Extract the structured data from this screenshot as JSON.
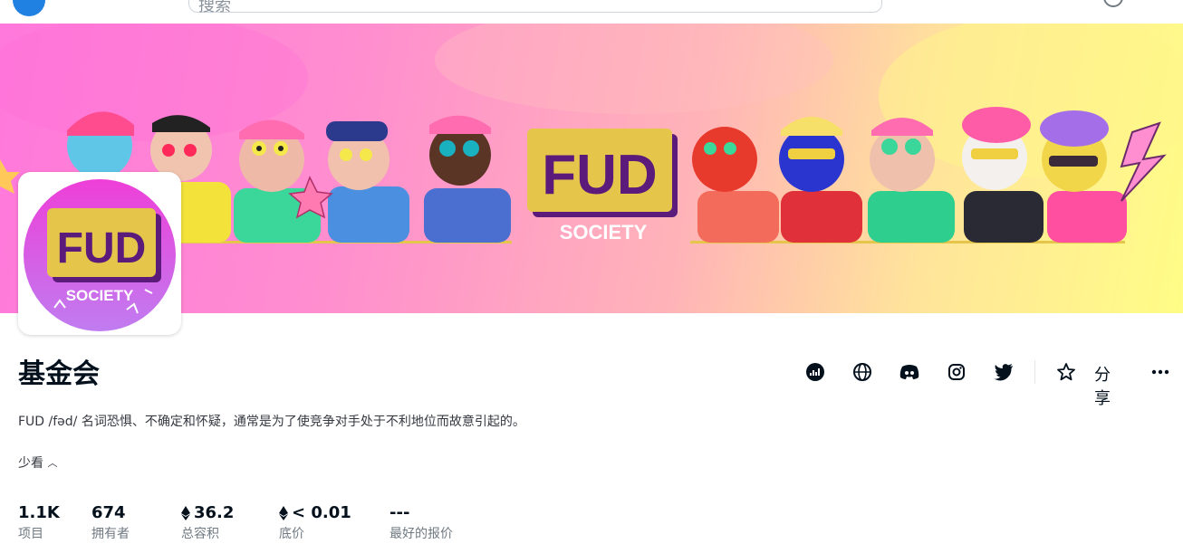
{
  "header": {
    "search_placeholder": "搜索"
  },
  "collection": {
    "title": "基金会",
    "description": "FUD /fəd/ 名词恐惧、不确定和怀疑，通常是为了使竞争对手处于不利地位而故意引起的。",
    "see_less": "少看",
    "banner_logo_text": "FUD",
    "banner_logo_sub": "SOCIETY",
    "avatar_logo_text": "FUD",
    "avatar_logo_sub": "SOCIETY"
  },
  "actions": {
    "share_label": "分享",
    "icons": [
      "activity-icon",
      "globe-icon",
      "discord-icon",
      "instagram-icon",
      "twitter-icon",
      "star-icon",
      "more-icon"
    ]
  },
  "stats": [
    {
      "value": "1.1K",
      "label": "项目",
      "eth": false
    },
    {
      "value": "674",
      "label": "拥有者",
      "eth": false
    },
    {
      "value": "36.2",
      "label": "总容积",
      "eth": true
    },
    {
      "value": "< 0.01",
      "label": "底价",
      "eth": true
    },
    {
      "value": "---",
      "label": "最好的报价",
      "eth": false
    }
  ],
  "colors": {
    "accent": "#2081e2",
    "text_primary": "#04111d",
    "text_secondary": "#707a83",
    "banner_left": "#ff78dc",
    "banner_right": "#fffd86",
    "logo_yellow": "#e6c64a",
    "logo_purple": "#5a1b7a"
  }
}
